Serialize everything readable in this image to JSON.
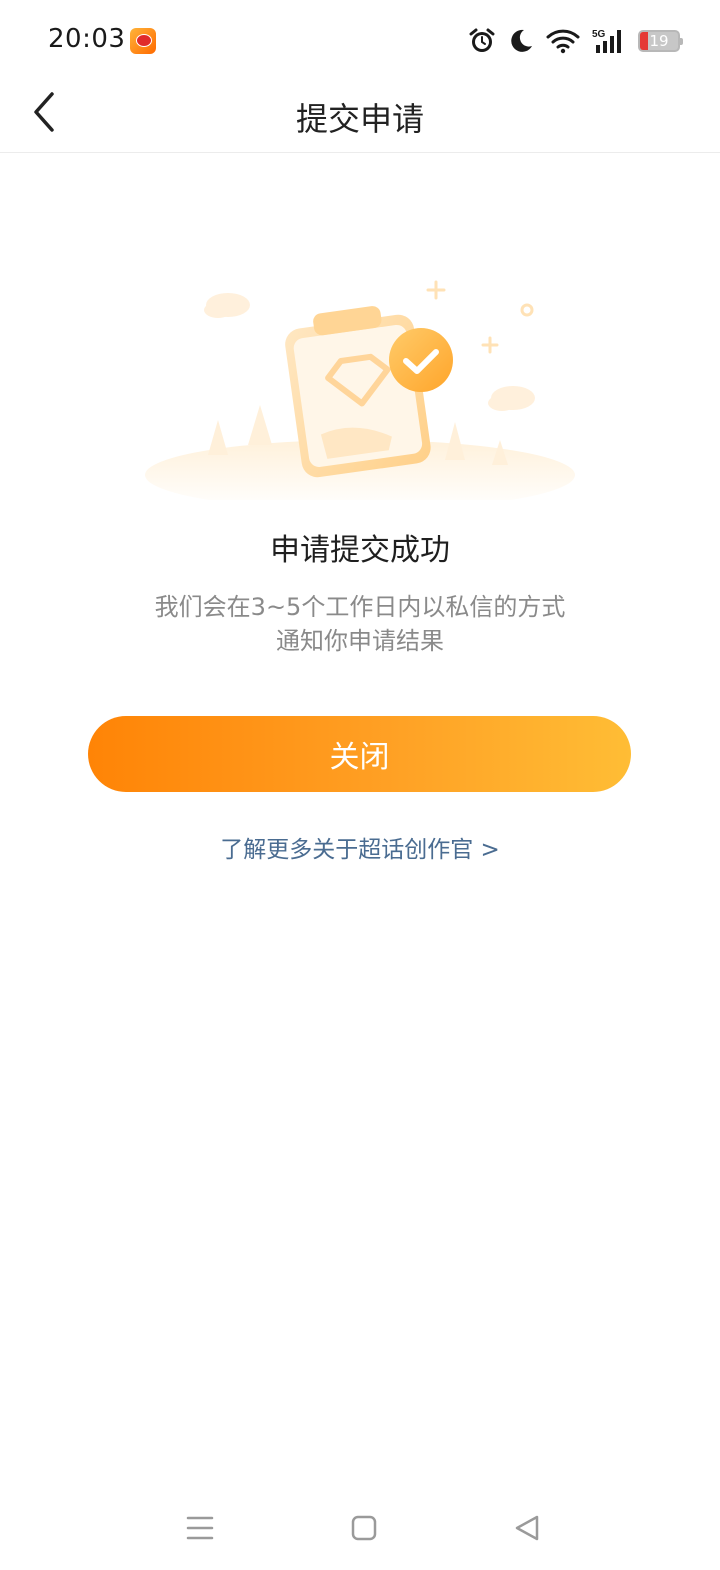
{
  "status_bar": {
    "time": "20:03",
    "battery_level": "19",
    "network": "5G",
    "icons": [
      "weibo-app-icon",
      "alarm-icon",
      "moon-icon",
      "wifi-icon",
      "signal-icon",
      "battery-icon"
    ]
  },
  "nav": {
    "title": "提交申请",
    "back_icon": "chevron-left-icon"
  },
  "result": {
    "title": "申请提交成功",
    "description_line1": "我们会在3~5个工作日内以私信的方式",
    "description_line2": "通知你申请结果"
  },
  "actions": {
    "close_label": "关闭",
    "learn_more_label": "了解更多关于超话创作官 >"
  },
  "system_nav": {
    "icons": [
      "menu-icon",
      "home-icon",
      "back-triangle-icon"
    ]
  },
  "colors": {
    "accent_start": "#ff8406",
    "accent_end": "#ffbd35",
    "link": "#4a6c91",
    "muted_text": "#8a8a8a"
  }
}
